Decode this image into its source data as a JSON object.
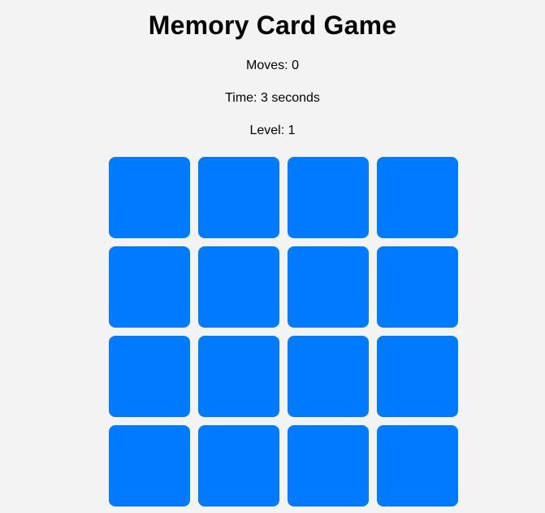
{
  "game": {
    "title": "Memory Card Game",
    "moves_label": "Moves:",
    "moves": "0",
    "time_label": "Time:",
    "time": "3",
    "time_unit": "seconds",
    "level_label": "Level:",
    "level": "1"
  },
  "board": {
    "rows": 4,
    "columns": 4,
    "card_back_color": "#007bff",
    "cards": [
      {
        "state": "face-down"
      },
      {
        "state": "face-down"
      },
      {
        "state": "face-down"
      },
      {
        "state": "face-down"
      },
      {
        "state": "face-down"
      },
      {
        "state": "face-down"
      },
      {
        "state": "face-down"
      },
      {
        "state": "face-down"
      },
      {
        "state": "face-down"
      },
      {
        "state": "face-down"
      },
      {
        "state": "face-down"
      },
      {
        "state": "face-down"
      },
      {
        "state": "face-down"
      },
      {
        "state": "face-down"
      },
      {
        "state": "face-down"
      },
      {
        "state": "face-down"
      }
    ]
  },
  "colors": {
    "background": "#f3f3f3",
    "text": "#000000"
  }
}
